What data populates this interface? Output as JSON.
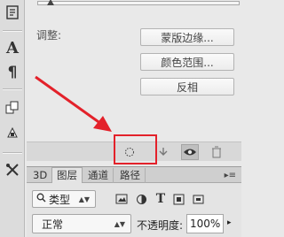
{
  "properties": {
    "adjust_label": "调整:",
    "buttons": [
      "蒙版边缘...",
      "颜色范围...",
      "反相"
    ]
  },
  "layers_panel": {
    "tabs": [
      "3D",
      "图层",
      "通道",
      "路径"
    ],
    "active_tab": "图层",
    "filter_kind": "类型",
    "blend_mode": "正常",
    "opacity_label": "不透明度:",
    "opacity_value": "100%"
  },
  "tools": [
    "text-tool-icon",
    "paragraph-icon",
    "layer-comps-icon",
    "clone-source-icon",
    "tools-icon"
  ],
  "colors": {
    "highlight": "#e3212a",
    "arrow": "#e3212a"
  }
}
